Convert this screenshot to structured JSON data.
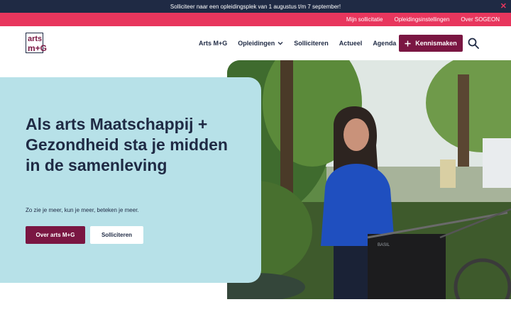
{
  "announcement": {
    "text": "Solliciteer naar een opleidingsplek van 1 augustus t/m 7 september!",
    "close_icon": "close-icon"
  },
  "util_nav": {
    "items": [
      "Mijn sollicitatie",
      "Opleidingsinstellingen",
      "Over SOGEON"
    ]
  },
  "logo": {
    "line1": "arts",
    "line2": "m+G"
  },
  "nav": {
    "items": [
      "Arts M+G",
      "Opleidingen",
      "Solliciteren",
      "Actueel",
      "Agenda"
    ],
    "dropdown_icon": "chevron-down-icon"
  },
  "cta": {
    "label": "Kennismaken",
    "icon": "plus-icon"
  },
  "search": {
    "icon": "search-icon"
  },
  "hero": {
    "title": "Als arts Maatschappij + Gezondheid sta je midden in de samenleving",
    "subtitle": "Zo zie je meer, kun je meer, beteken je meer.",
    "primary_button": "Over arts M+G",
    "secondary_button": "Solliciteren"
  },
  "photo": {
    "basket_label": "BASIL"
  },
  "colors": {
    "navy": "#1f2a44",
    "pink": "#e8365d",
    "burgundy": "#7a1642",
    "light_blue": "#b7e1e8"
  }
}
